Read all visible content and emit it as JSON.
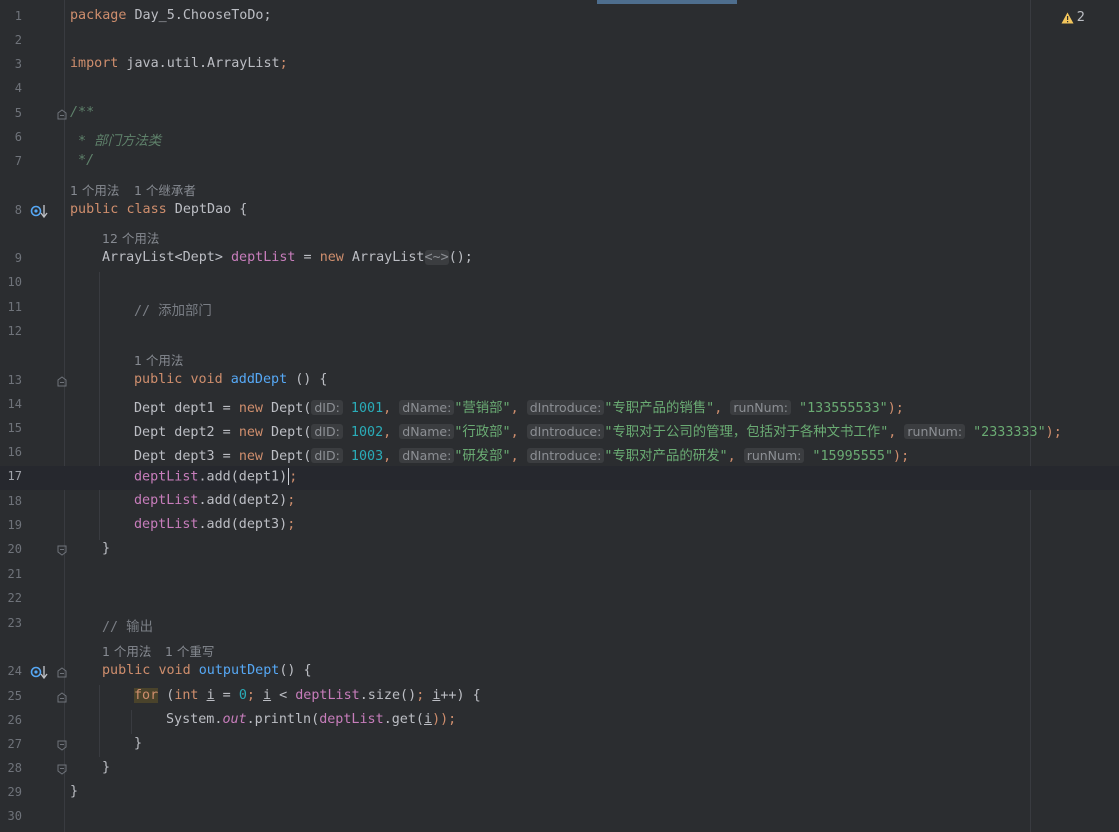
{
  "warnings": {
    "icon": "warning-icon",
    "count": "2"
  },
  "lines": {
    "l1": "1",
    "l2": "2",
    "l3": "3",
    "l4": "4",
    "l5": "5",
    "l6": "6",
    "l7": "7",
    "l8": "8",
    "l9": "9",
    "l10": "10",
    "l11": "11",
    "l12": "12",
    "l13": "13",
    "l14": "14",
    "l15": "15",
    "l16": "16",
    "l17": "17",
    "l18": "18",
    "l19": "19",
    "l20": "20",
    "l21": "21",
    "l22": "22",
    "l23": "23",
    "l24": "24",
    "l25": "25",
    "l26": "26",
    "l27": "27",
    "l28": "28",
    "l29": "29",
    "l30": "30"
  },
  "hints": {
    "class_usages": "1 个用法",
    "class_inheritors": "1 个继承者",
    "field_usages": "12 个用法",
    "method_add_usages": "1 个用法",
    "method_output_usages": "1 个用法",
    "method_output_overrides": "1 个重写"
  },
  "code": {
    "package_kw": "package",
    "package_name": " Day_5.ChooseToDo;",
    "import_kw": "import",
    "import_name": " java.util.ArrayList",
    "semicolon": ";",
    "doc_open": "/**",
    "doc_body": " * 部门方法类",
    "doc_close": " */",
    "public_kw": "public",
    "class_kw": "class",
    "class_name": " DeptDao {",
    "field_type": "ArrayList<Dept> ",
    "field_name": "deptList",
    "eq": " = ",
    "new_kw": "new",
    "field_init": " ArrayList",
    "diamond": "<~>",
    "field_end": "();",
    "comment_add": "// 添加部门",
    "void_kw": "void",
    "add_method": "addDept",
    "add_sig": " () {",
    "dept_decl_1": "Dept dept1 = ",
    "dept_decl_2": "Dept dept2 = ",
    "dept_decl_3": "Dept dept3 = ",
    "dept_ctor": " Dept(",
    "hint_did": "dID:",
    "hint_dname": "dName:",
    "hint_dintro": "dIntroduce:",
    "hint_runnum": "runNum:",
    "d1_id": "1001",
    "d1_name": "\"营销部\"",
    "d1_intro": "\"专职产品的销售\"",
    "d1_run": "\"133555533\"",
    "d2_id": "1002",
    "d2_name": "\"行政部\"",
    "d2_intro": "\"专职对于公司的管理，包括对于各种文书工作\"",
    "d2_run": "\"2333333\"",
    "d3_id": "1003",
    "d3_name": "\"研发部\"",
    "d3_intro": "\"专职对产品的研发\"",
    "d3_run": "\"15995555\"",
    "comma": ", ",
    "close_paren": ");",
    "list_ref": "deptList",
    "add_call_1": ".add(dept1)",
    "add_call_2": ".add(dept2)",
    "add_call_3": ".add(dept3)",
    "close_brace": "}",
    "comment_output": "// 输出",
    "output_method": "outputDept",
    "output_sig": "() {",
    "for_kw": "for",
    "for_open": " (",
    "int_kw": "int",
    "i_var": "i",
    "zero": "0",
    "lt": " < ",
    "size_call": ".size()",
    "incr": "++) {",
    "sys": "System.",
    "out": "out",
    "println": ".println(",
    "get_call": ".get(",
    "close_call": "));"
  }
}
